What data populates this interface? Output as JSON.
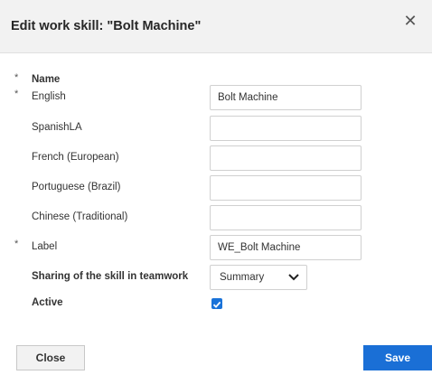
{
  "dialog": {
    "title": "Edit work skill: \"Bolt Machine\"",
    "close_icon": "close-icon"
  },
  "form": {
    "name_section": {
      "required_mark": "*",
      "label": "Name"
    },
    "fields": [
      {
        "key": "english",
        "required_mark": "*",
        "label": "English",
        "value": "Bolt Machine"
      },
      {
        "key": "spanishla",
        "required_mark": "",
        "label": "SpanishLA",
        "value": ""
      },
      {
        "key": "french",
        "required_mark": "",
        "label": "French (European)",
        "value": ""
      },
      {
        "key": "portuguese",
        "required_mark": "",
        "label": "Portuguese (Brazil)",
        "value": ""
      },
      {
        "key": "chinese",
        "required_mark": "",
        "label": "Chinese (Traditional)",
        "value": ""
      },
      {
        "key": "label",
        "required_mark": "*",
        "label": "Label",
        "value": "WE_Bolt Machine"
      }
    ],
    "sharing": {
      "label": "Sharing of the skill in teamwork",
      "selected": "Summary",
      "icon": "chevron-down-icon"
    },
    "active": {
      "label": "Active",
      "checked": true,
      "icon": "check-icon"
    }
  },
  "footer": {
    "close_label": "Close",
    "save_label": "Save"
  },
  "colors": {
    "header_bg": "#f2f2f2",
    "primary": "#1a6fd6",
    "checkbox": "#1a73d9"
  }
}
